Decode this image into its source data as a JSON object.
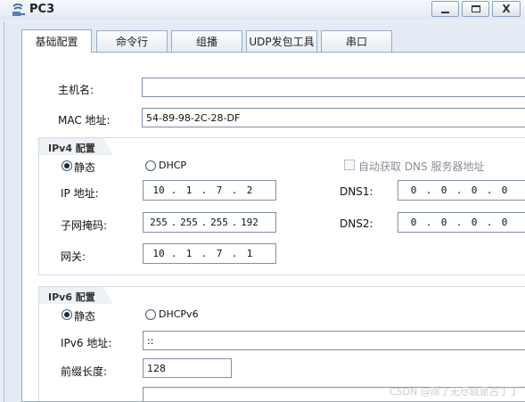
{
  "window": {
    "title": "PC3",
    "controls": {
      "minimize": "_",
      "maximize": "□",
      "close": "X"
    }
  },
  "tabs": [
    {
      "label": "基础配置",
      "active": true
    },
    {
      "label": "命令行",
      "active": false
    },
    {
      "label": "组播",
      "active": false
    },
    {
      "label": "UDP发包工具",
      "active": false
    },
    {
      "label": "串口",
      "active": false
    }
  ],
  "basic": {
    "hostname_label": "主机名:",
    "hostname_value": "",
    "mac_label": "MAC 地址:",
    "mac_value": "54-89-98-2C-28-DF"
  },
  "ipv4": {
    "group_title": "IPv4 配置",
    "static_label": "静态",
    "dhcp_label": "DHCP",
    "mode": "static",
    "auto_dns_label": "自动获取 DNS 服务器地址",
    "ip_label": "IP 地址:",
    "ip": [
      "10",
      "1",
      "7",
      "2"
    ],
    "mask_label": "子网掩码:",
    "mask": [
      "255",
      "255",
      "255",
      "192"
    ],
    "gateway_label": "网关:",
    "gateway": [
      "10",
      "1",
      "7",
      "1"
    ],
    "dns1_label": "DNS1:",
    "dns1": [
      "0",
      "0",
      "0",
      "0"
    ],
    "dns2_label": "DNS2:",
    "dns2": [
      "0",
      "0",
      "0",
      "0"
    ]
  },
  "ipv6": {
    "group_title": "IPv6 配置",
    "static_label": "静态",
    "dhcp_label": "DHCPv6",
    "mode": "static",
    "ip_label": "IPv6 地址:",
    "ip_value": "::",
    "prefix_label": "前缀长度:",
    "prefix_value": "128"
  },
  "watermark": "CSDN @除了无尽就是古丁丁"
}
